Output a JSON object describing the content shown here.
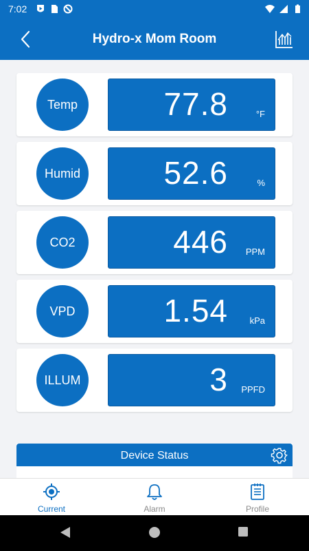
{
  "status_bar": {
    "time": "7:02",
    "icons": [
      "play-protect-icon",
      "sim-card-icon",
      "do-not-disturb-icon",
      "wifi-icon",
      "signal-icon",
      "battery-icon"
    ]
  },
  "app_bar": {
    "title": "Hydro-x Mom Room",
    "back_icon": "chevron-left-icon",
    "chart_icon": "chart-icon"
  },
  "sensors": [
    {
      "label": "Temp",
      "value": "77.8",
      "unit": "°F"
    },
    {
      "label": "Humid",
      "value": "52.6",
      "unit": "%"
    },
    {
      "label": "CO2",
      "value": "446",
      "unit": "PPM"
    },
    {
      "label": "VPD",
      "value": "1.54",
      "unit": "kPa"
    },
    {
      "label": "ILLUM",
      "value": "3",
      "unit": "PPFD"
    }
  ],
  "device_status": {
    "title": "Device Status",
    "settings_icon": "gear-icon"
  },
  "bottom_nav": [
    {
      "label": "Current",
      "icon": "target-icon",
      "active": true
    },
    {
      "label": "Alarm",
      "icon": "bell-icon",
      "active": false
    },
    {
      "label": "Profile",
      "icon": "document-icon",
      "active": false
    }
  ],
  "system_nav": [
    "back-triangle-icon",
    "home-circle-icon",
    "recents-square-icon"
  ],
  "colors": {
    "primary": "#0c6fc2",
    "background": "#f2f3f6",
    "inactive": "#8a8a8a"
  }
}
